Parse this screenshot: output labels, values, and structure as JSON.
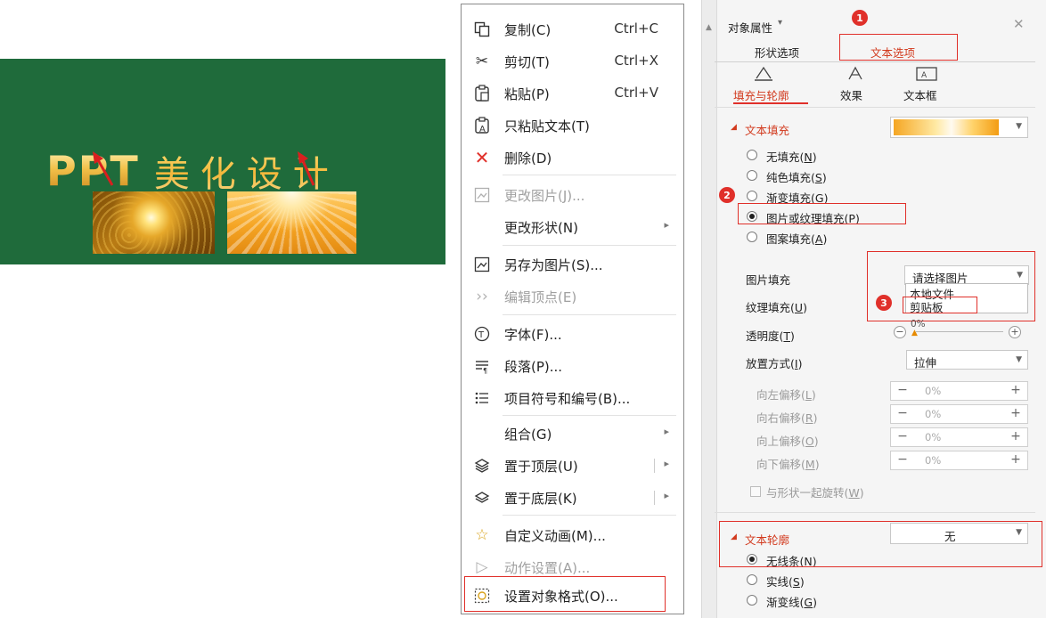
{
  "slide": {
    "title_latin": "PPT",
    "title_cjk": "美化设计",
    "colors": {
      "background": "#1f6b3b",
      "gold": "#f2c14a",
      "arrow": "#d91f1f"
    }
  },
  "context_menu": {
    "items": [
      {
        "icon": "copy-icon",
        "label": "复制(C)",
        "shortcut": "Ctrl+C",
        "enabled": true
      },
      {
        "icon": "scissors-icon",
        "label": "剪切(T)",
        "shortcut": "Ctrl+X",
        "enabled": true
      },
      {
        "icon": "paste-icon",
        "label": "粘贴(P)",
        "shortcut": "Ctrl+V",
        "enabled": true
      },
      {
        "icon": "paste-text-icon",
        "label": "只粘贴文本(T)",
        "enabled": true
      },
      {
        "icon": "delete-icon",
        "label": "删除(D)",
        "enabled": true
      },
      {
        "icon": "change-picture-icon",
        "label": "更改图片(J)...",
        "enabled": false
      },
      {
        "label": "更改形状(N)",
        "submenu": true,
        "enabled": true
      },
      {
        "icon": "save-picture-icon",
        "label": "另存为图片(S)...",
        "enabled": true
      },
      {
        "icon": "edit-points-icon",
        "label": "编辑顶点(E)",
        "enabled": false
      },
      {
        "icon": "font-icon",
        "label": "字体(F)...",
        "enabled": true
      },
      {
        "icon": "paragraph-icon",
        "label": "段落(P)...",
        "enabled": true
      },
      {
        "icon": "bullets-icon",
        "label": "项目符号和编号(B)...",
        "enabled": true
      },
      {
        "label": "组合(G)",
        "submenu": true,
        "enabled": true
      },
      {
        "icon": "bring-front-icon",
        "label": "置于顶层(U)",
        "submenu": true,
        "enabled": true
      },
      {
        "icon": "send-back-icon",
        "label": "置于底层(K)",
        "submenu": true,
        "enabled": true
      },
      {
        "icon": "custom-animation-icon",
        "label": "自定义动画(M)...",
        "enabled": true
      },
      {
        "icon": "action-icon",
        "label": "动作设置(A)...",
        "enabled": false
      },
      {
        "icon": "format-object-icon",
        "label": "设置对象格式(O)...",
        "enabled": true
      }
    ]
  },
  "panel": {
    "title": "对象属性",
    "tabs": {
      "shape": "形状选项",
      "text": "文本选项"
    },
    "subtabs": {
      "fill": "填充与轮廓",
      "effect": "效果",
      "textbox": "文本框"
    },
    "text_fill": {
      "header": "文本填充",
      "options": [
        {
          "label": "无填充",
          "key": "N",
          "selected": false
        },
        {
          "label": "纯色填充",
          "key": "S",
          "selected": false
        },
        {
          "label": "渐变填充",
          "key": "G",
          "selected": false
        },
        {
          "label": "图片或纹理填充",
          "key": "P",
          "selected": true
        },
        {
          "label": "图案填充",
          "key": "A",
          "selected": false
        }
      ],
      "picture_fill_label": "图片填充",
      "picture_fill_value": "请选择图片",
      "dropdown_options": [
        "本地文件",
        "剪贴板"
      ],
      "texture_fill_label": "纹理填充",
      "texture_fill_key": "U",
      "transparency_label": "透明度",
      "transparency_key": "T",
      "transparency_value": "0%",
      "placement_label": "放置方式",
      "placement_key": "I",
      "placement_value": "拉伸",
      "offsets": [
        {
          "label": "向左偏移",
          "key": "L",
          "value": "0%"
        },
        {
          "label": "向右偏移",
          "key": "R",
          "value": "0%"
        },
        {
          "label": "向上偏移",
          "key": "O",
          "value": "0%"
        },
        {
          "label": "向下偏移",
          "key": "M",
          "value": "0%"
        }
      ],
      "rotate_with_shape": "与形状一起旋转",
      "rotate_key": "W"
    },
    "text_outline": {
      "header": "文本轮廓",
      "value": "无",
      "options": [
        {
          "label": "无线条",
          "key": "N",
          "selected": true
        },
        {
          "label": "实线",
          "key": "S",
          "selected": false
        },
        {
          "label": "渐变线",
          "key": "G",
          "selected": false
        }
      ]
    },
    "steps": [
      "1",
      "2",
      "3"
    ],
    "colors": {
      "accent_red": "#e0302a",
      "tab_selected_text": "#d23a1e"
    }
  }
}
